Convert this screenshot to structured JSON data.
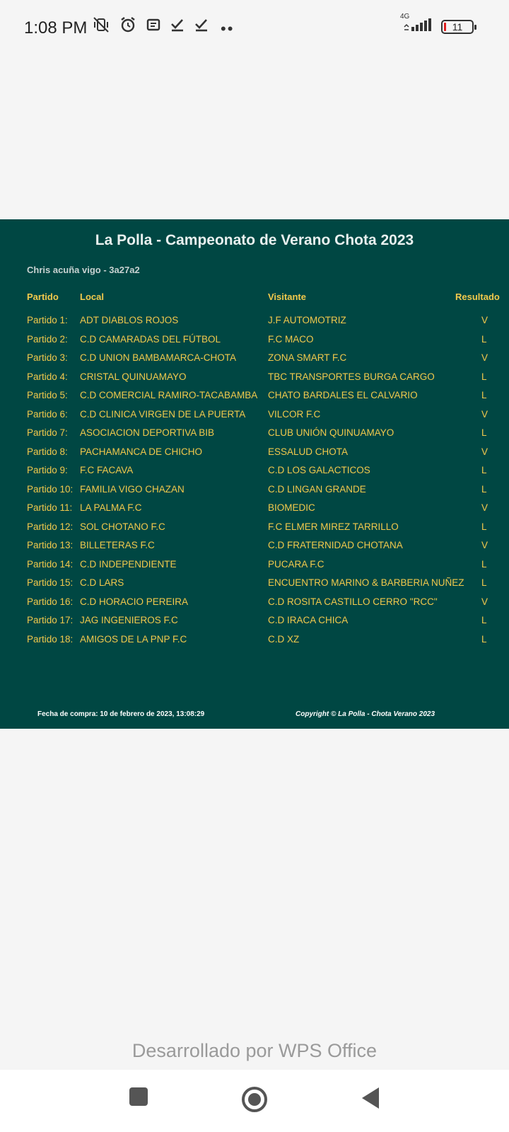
{
  "status_bar": {
    "time": "1:08 PM",
    "network_label": "4G",
    "battery_level": "11",
    "icons": [
      "vibrate-off-icon",
      "alarm-icon",
      "notes-icon",
      "check-icon",
      "check-icon",
      "more-dots-icon",
      "signal-icon",
      "battery-icon"
    ]
  },
  "document": {
    "title": "La Polla - Campeonato de Verano Chota 2023",
    "user": "Chris acuña vigo - 3a27a2",
    "headers": {
      "partido": "Partido",
      "local": "Local",
      "visitante": "Visitante",
      "resultado": "Resultado"
    },
    "matches": [
      {
        "num": "Partido 1:",
        "local": "ADT DIABLOS ROJOS",
        "visitante": "J.F AUTOMOTRIZ",
        "resultado": "V"
      },
      {
        "num": "Partido 2:",
        "local": "C.D CAMARADAS DEL FÚTBOL",
        "visitante": "F.C MACO",
        "resultado": "L"
      },
      {
        "num": "Partido 3:",
        "local": "C.D UNION BAMBAMARCA-CHOTA",
        "visitante": "ZONA SMART F.C",
        "resultado": "V"
      },
      {
        "num": "Partido 4:",
        "local": "CRISTAL QUINUAMAYO",
        "visitante": "TBC TRANSPORTES BURGA CARGO",
        "resultado": "L"
      },
      {
        "num": "Partido 5:",
        "local": "C.D COMERCIAL RAMIRO-TACABAMBA",
        "visitante": "CHATO BARDALES EL CALVARIO",
        "resultado": "L"
      },
      {
        "num": "Partido 6:",
        "local": "C.D CLINICA VIRGEN DE LA PUERTA",
        "visitante": "VILCOR F.C",
        "resultado": "V"
      },
      {
        "num": "Partido 7:",
        "local": "ASOCIACION DEPORTIVA BIB",
        "visitante": "CLUB UNIÓN QUINUAMAYO",
        "resultado": "L"
      },
      {
        "num": "Partido 8:",
        "local": "PACHAMANCA DE CHICHO",
        "visitante": "ESSALUD CHOTA",
        "resultado": "V"
      },
      {
        "num": "Partido 9:",
        "local": "F.C FACAVA",
        "visitante": "C.D LOS GALACTICOS",
        "resultado": "L"
      },
      {
        "num": "Partido 10:",
        "local": "FAMILIA VIGO CHAZAN",
        "visitante": "C.D LINGAN GRANDE",
        "resultado": "L"
      },
      {
        "num": "Partido 11:",
        "local": "LA PALMA F.C",
        "visitante": "BIOMEDIC",
        "resultado": "V"
      },
      {
        "num": "Partido 12:",
        "local": "SOL CHOTANO F.C",
        "visitante": "F.C ELMER MIREZ TARRILLO",
        "resultado": "L"
      },
      {
        "num": "Partido 13:",
        "local": "BILLETERAS F.C",
        "visitante": "C.D FRATERNIDAD CHOTANA",
        "resultado": "V"
      },
      {
        "num": "Partido 14:",
        "local": "C.D INDEPENDIENTE",
        "visitante": "PUCARA F.C",
        "resultado": "L"
      },
      {
        "num": "Partido 15:",
        "local": "C.D LARS",
        "visitante": "ENCUENTRO MARINO & BARBERIA NUÑEZ",
        "resultado": "L"
      },
      {
        "num": "Partido 16:",
        "local": "C.D HORACIO PEREIRA",
        "visitante": "C.D ROSITA CASTILLO CERRO \"RCC\"",
        "resultado": "V"
      },
      {
        "num": "Partido 17:",
        "local": "JAG INGENIEROS F.C",
        "visitante": "C.D IRACA CHICA",
        "resultado": "L"
      },
      {
        "num": "Partido 18:",
        "local": "AMIGOS DE LA PNP F.C",
        "visitante": "C.D XZ",
        "resultado": "L"
      }
    ],
    "footer_left": "Fecha de compra: 10 de febrero de 2023, 13:08:29",
    "footer_right": "Copyright © La Polla - Chota Verano 2023"
  },
  "watermark": "Desarrollado por WPS Office",
  "navbar": {
    "icons": [
      "recents-square-icon",
      "home-circle-icon",
      "back-triangle-icon"
    ]
  },
  "colors": {
    "doc_background": "#004743",
    "doc_text": "#f2c94c",
    "page_background": "#f5f5f5"
  }
}
